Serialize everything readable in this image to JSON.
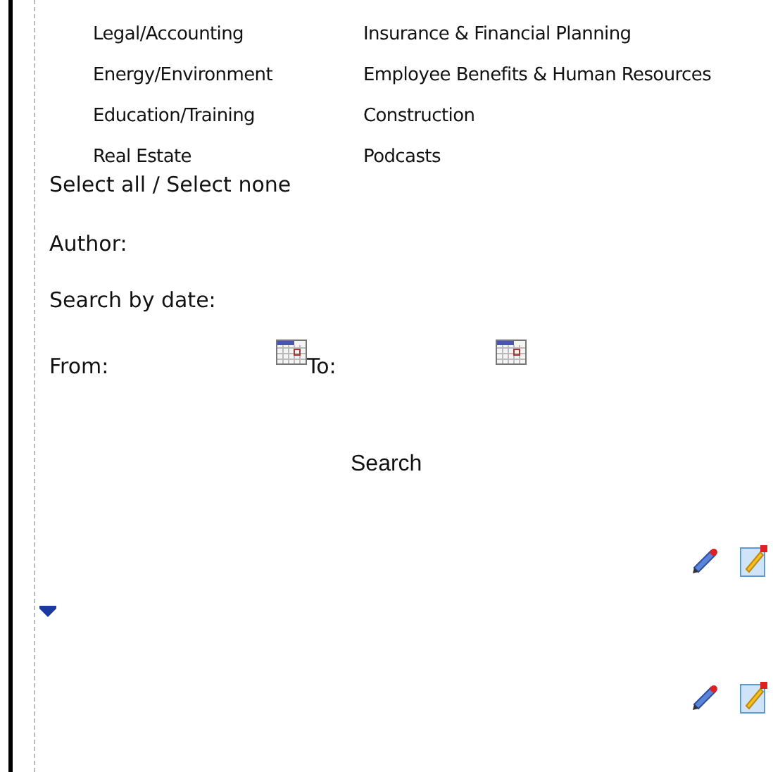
{
  "categories": [
    [
      "Legal/Accounting",
      "Insurance & Financial Planning"
    ],
    [
      "Energy/Environment",
      "Employee Benefits & Human Resources"
    ],
    [
      "Education/Training",
      "Construction"
    ],
    [
      "Real Estate",
      "Podcasts"
    ]
  ],
  "select_links": "Select all / Select none",
  "author_label": "Author:",
  "date_label": "Search by date:",
  "from_label": "From:",
  "to_label": "To:",
  "search_button": "Search"
}
